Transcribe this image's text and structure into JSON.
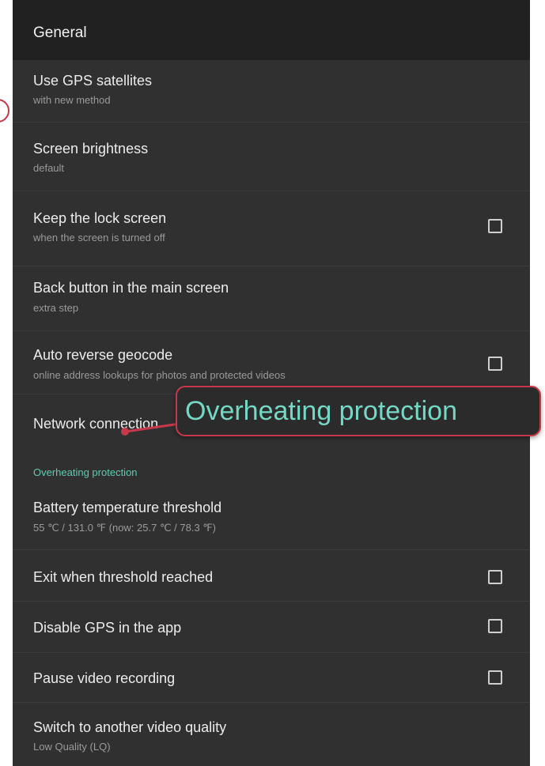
{
  "header": {
    "title": "General"
  },
  "general": {
    "gps": {
      "title": "Use GPS satellites",
      "subtitle": "with new method"
    },
    "brightness": {
      "title": "Screen brightness",
      "subtitle": "default"
    },
    "lock_screen": {
      "title": "Keep the lock screen",
      "subtitle": "when the screen is turned off",
      "checked": false
    },
    "back_button": {
      "title": "Back button in the main screen",
      "subtitle": "extra step"
    },
    "reverse_geocode": {
      "title": "Auto reverse geocode",
      "subtitle": "online address lookups for photos and protected videos",
      "checked": false
    },
    "network": {
      "title": "Network connection"
    }
  },
  "overheating": {
    "section_title": "Overheating protection",
    "battery_threshold": {
      "title": "Battery temperature threshold",
      "subtitle": "55 ℃ / 131.0 ℉ (now: 25.7 ℃ / 78.3 ℉)"
    },
    "exit_threshold": {
      "title": "Exit when threshold reached",
      "checked": false
    },
    "disable_gps": {
      "title": "Disable GPS in the app",
      "checked": false
    },
    "pause_video": {
      "title": "Pause video recording",
      "checked": false
    },
    "switch_quality": {
      "title": "Switch to another video quality",
      "subtitle": "Low Quality (LQ)"
    }
  },
  "annotation": {
    "callout_text": "Overheating protection",
    "accent_color": "#c8384a",
    "callout_text_color": "#74d8c4"
  },
  "colors": {
    "background": "#303030",
    "appbar": "#212121",
    "section_header": "#5ecbb3"
  }
}
